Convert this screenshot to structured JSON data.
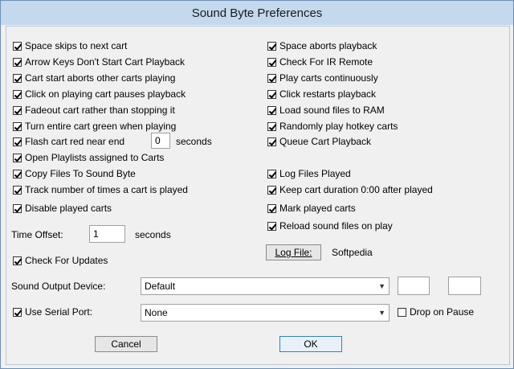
{
  "window": {
    "title": "Sound Byte Preferences"
  },
  "left_checks": [
    {
      "label": "Space skips to next cart",
      "checked": true
    },
    {
      "label": "Arrow Keys Don't Start Cart Playback",
      "checked": true
    },
    {
      "label": "Cart start aborts other carts playing",
      "checked": true
    },
    {
      "label": "Click on playing cart pauses playback",
      "checked": true
    },
    {
      "label": "Fadeout cart rather than stopping it",
      "checked": true
    },
    {
      "label": "Turn entire cart green when playing",
      "checked": true
    },
    {
      "label": "Flash cart red near end",
      "checked": true
    },
    {
      "label": "Open Playlists assigned to Carts",
      "checked": true
    },
    {
      "label": "Copy Files To Sound Byte",
      "checked": true
    },
    {
      "label": "Track number of times a cart is played",
      "checked": true
    },
    {
      "label": "Disable played carts",
      "checked": true
    }
  ],
  "flash": {
    "value": "0",
    "unit": "seconds"
  },
  "right_checks": [
    {
      "label": "Space aborts playback",
      "checked": true
    },
    {
      "label": "Check For IR Remote",
      "checked": true
    },
    {
      "label": "Play carts continuously",
      "checked": true
    },
    {
      "label": "Click restarts playback",
      "checked": true
    },
    {
      "label": "Load sound files to RAM",
      "checked": true
    },
    {
      "label": "Randomly play hotkey carts",
      "checked": true
    },
    {
      "label": "Queue Cart Playback",
      "checked": true
    },
    {
      "label": "Log Files Played",
      "checked": true
    },
    {
      "label": "Keep cart duration 0:00 after played",
      "checked": true
    },
    {
      "label": "Mark played carts",
      "checked": true
    },
    {
      "label": "Reload sound files on play",
      "checked": true
    }
  ],
  "time_offset": {
    "label": "Time Offset:",
    "value": "1",
    "unit": "seconds"
  },
  "check_updates": {
    "label": "Check For Updates",
    "checked": true
  },
  "log_file": {
    "button": "Log File:",
    "value": "Softpedia"
  },
  "sound_output": {
    "label": "Sound Output Device:",
    "selected": "Default",
    "field1": "",
    "field2": ""
  },
  "serial": {
    "label": "Use Serial Port:",
    "checked": true,
    "selected": "None",
    "drop_label": "Drop on Pause",
    "drop_checked": false
  },
  "buttons": {
    "cancel": "Cancel",
    "ok": "OK"
  }
}
